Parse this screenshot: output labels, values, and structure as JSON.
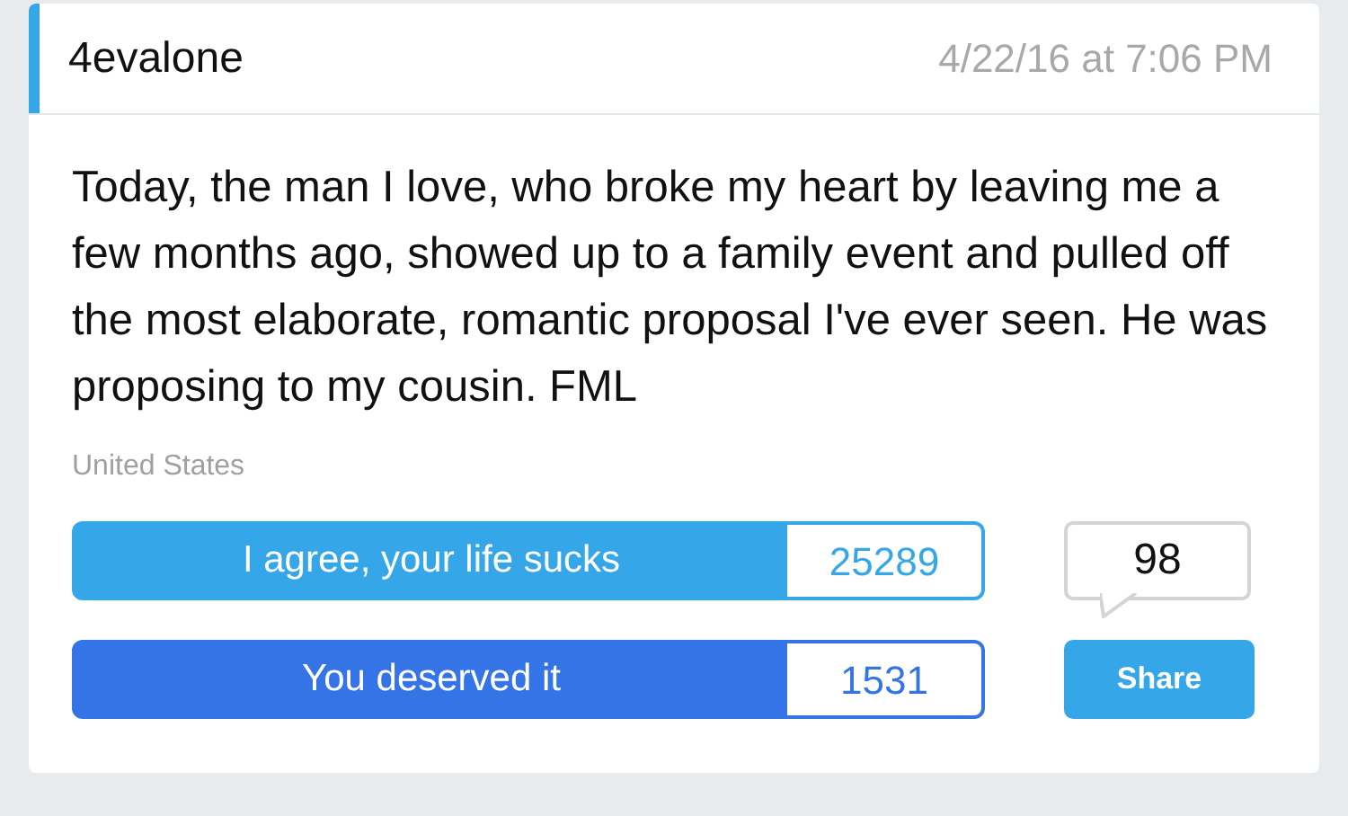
{
  "post": {
    "author": "4evalone",
    "timestamp": "4/22/16 at 7:06 PM",
    "text": "Today, the man I love, who broke my heart by leaving me a few months ago, showed up to a family event and pulled off the most elaborate, romantic proposal I've ever seen. He was proposing to my cousin. FML",
    "location": "United States"
  },
  "votes": [
    {
      "label": "I agree, your life sucks",
      "count": "25289",
      "color": "#35a6e8"
    },
    {
      "label": "You deserved it",
      "count": "1531",
      "color": "#3474e6"
    }
  ],
  "comments": {
    "count": "98"
  },
  "share": {
    "label": "Share"
  }
}
